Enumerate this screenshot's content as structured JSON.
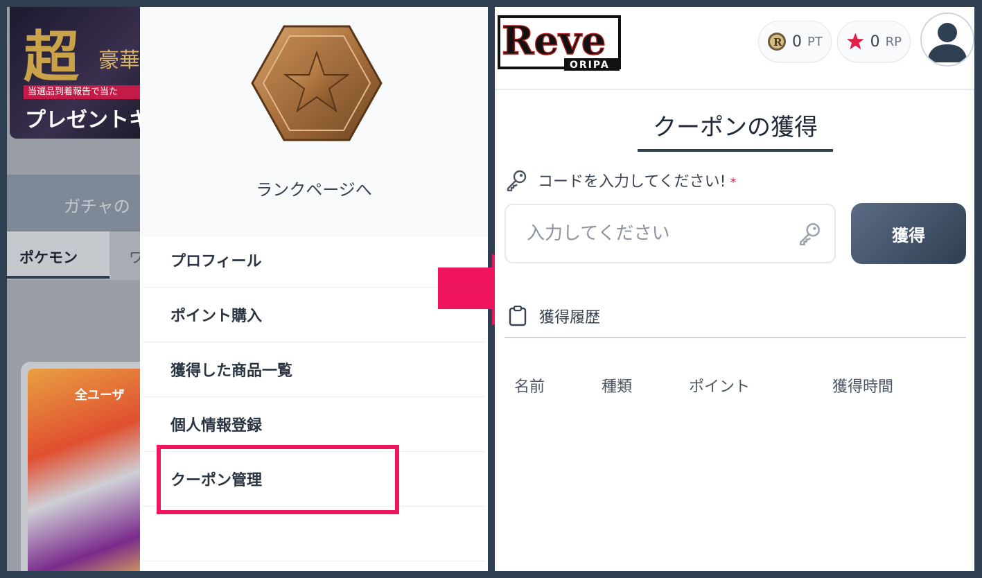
{
  "background": {
    "banner_big": "超",
    "banner_small": "豪華",
    "banner_strip": "当選品到着報告で当た",
    "banner_gift": "プレゼントキ",
    "tab_label": "ガチャの",
    "category_active": "ポケモン",
    "category_next": "ワ",
    "card_text": "全ユーザ"
  },
  "menu": {
    "rank_link": "ランクページへ",
    "items": [
      {
        "label": "プロフィール"
      },
      {
        "label": "ポイント購入"
      },
      {
        "label": "獲得した商品一覧"
      },
      {
        "label": "個人情報登録"
      },
      {
        "label": "クーポン管理"
      }
    ],
    "highlight_color": "#f0155f"
  },
  "arrow_color": "#f0155f",
  "header": {
    "logo_text": "Reve",
    "logo_sub": "ORIPA",
    "pt_value": "0",
    "pt_unit": "PT",
    "rp_value": "0",
    "rp_unit": "RP"
  },
  "coupon": {
    "title": "クーポンの獲得",
    "code_label": "コードを入力してください!",
    "required_mark": "*",
    "input_placeholder": "入力してください",
    "submit_label": "獲得",
    "history_label": "獲得履歴",
    "columns": [
      "名前",
      "種類",
      "ポイント",
      "獲得時間"
    ]
  },
  "colors": {
    "accent": "#2f3f52",
    "highlight": "#f0155f",
    "star": "#e11d48"
  }
}
